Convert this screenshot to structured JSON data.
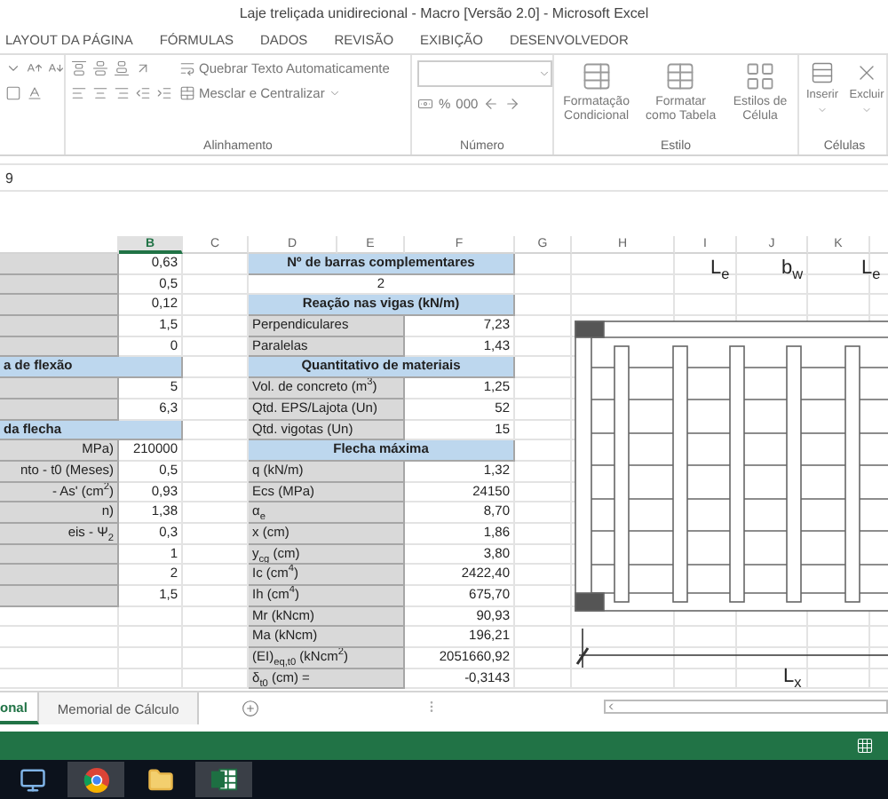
{
  "window": {
    "title": "Laje treliçada unidirecional - Macro [Versão 2.0] - Microsoft Excel"
  },
  "ribbon_tabs": [
    {
      "label": "LAYOUT DA PÁGINA",
      "selected": false
    },
    {
      "label": "FÓRMULAS",
      "selected": false
    },
    {
      "label": "DADOS",
      "selected": false
    },
    {
      "label": "REVISÃO",
      "selected": false
    },
    {
      "label": "EXIBIÇÃO",
      "selected": false
    },
    {
      "label": "DESENVOLVEDOR",
      "selected": false
    }
  ],
  "ribbon": {
    "alignment": {
      "wrap_text": "Quebrar Texto Automaticamente",
      "merge_center": "Mesclar e Centralizar",
      "label": "Alinhamento"
    },
    "number": {
      "buttons": [
        "%",
        "000"
      ],
      "label": "Número"
    },
    "styles": {
      "buttons": [
        "Formatação Condicional",
        "Formatar como Tabela",
        "Estilos de Célula"
      ],
      "label": "Estilo"
    },
    "cells": {
      "buttons": [
        "Inserir",
        "Excluir"
      ],
      "label": "Células"
    }
  },
  "formula_bar": {
    "value": "9"
  },
  "sheet": {
    "columns": [
      {
        "label": "B",
        "selected": true
      },
      {
        "label": "C",
        "selected": false
      },
      {
        "label": "D",
        "selected": false
      },
      {
        "label": "E",
        "selected": false
      },
      {
        "label": "F",
        "selected": false
      },
      {
        "label": "G",
        "selected": false
      },
      {
        "label": "H",
        "selected": false
      },
      {
        "label": "I",
        "selected": false
      },
      {
        "label": "J",
        "selected": false
      },
      {
        "label": "K",
        "selected": false
      }
    ],
    "left_rows": [
      {
        "kind": "value",
        "value": "0,63"
      },
      {
        "kind": "value",
        "value": "0,5"
      },
      {
        "kind": "value",
        "value": "0,12"
      },
      {
        "kind": "value",
        "value": "1,5"
      },
      {
        "kind": "value",
        "value": "0"
      },
      {
        "kind": "header",
        "label": "a de flexão"
      },
      {
        "kind": "value",
        "value": "5"
      },
      {
        "kind": "value",
        "value": "6,3"
      },
      {
        "kind": "header",
        "label": "da flecha"
      },
      {
        "kind": "value",
        "label": "MPa)",
        "value": "210000"
      },
      {
        "kind": "value",
        "label": "nto - t0 (Meses)",
        "value": "0,5"
      },
      {
        "kind": "value",
        "label": "- As' (cm$^{2}$)",
        "value": "0,93"
      },
      {
        "kind": "value",
        "label": "n)",
        "value": "1,38"
      },
      {
        "kind": "value",
        "label": "eis - Ψ$_{2}$",
        "value": "0,3"
      },
      {
        "kind": "value",
        "value": "1"
      },
      {
        "kind": "value",
        "value": "2"
      },
      {
        "kind": "value",
        "value": "1,5"
      }
    ],
    "right_rows": [
      {
        "kind": "header",
        "label": "Nº de barras complementares"
      },
      {
        "kind": "center",
        "value": "2"
      },
      {
        "kind": "header",
        "label": "Reação nas vigas (kN/m)"
      },
      {
        "kind": "value",
        "label": "Perpendiculares",
        "value": "7,23"
      },
      {
        "kind": "value",
        "label": "Paralelas",
        "value": "1,43"
      },
      {
        "kind": "header",
        "label": "Quantitativo de materiais"
      },
      {
        "kind": "value",
        "label": "Vol. de concreto (m$^{3}$)",
        "value": "1,25"
      },
      {
        "kind": "value",
        "label": "Qtd. EPS/Lajota (Un)",
        "value": "52"
      },
      {
        "kind": "value",
        "label": "Qtd. vigotas (Un)",
        "value": "15"
      },
      {
        "kind": "header",
        "label": "Flecha máxima"
      },
      {
        "kind": "value",
        "label": "q (kN/m)",
        "value": "1,32"
      },
      {
        "kind": "value",
        "label": "Ecs (MPa)",
        "value": "24150"
      },
      {
        "kind": "value",
        "label": "α$_{e}$",
        "value": "8,70"
      },
      {
        "kind": "value",
        "label": "x (cm)",
        "value": "1,86"
      },
      {
        "kind": "value",
        "label": "y$_{cg}$ (cm)",
        "value": "3,80"
      },
      {
        "kind": "value",
        "label": "Ic (cm$^{4}$)",
        "value": "2422,40"
      },
      {
        "kind": "value",
        "label": "Ih (cm$^{4}$)",
        "value": "675,70"
      },
      {
        "kind": "value",
        "label": "Mr (kNcm)",
        "value": "90,93"
      },
      {
        "kind": "value",
        "label": "Ma (kNcm)",
        "value": "196,21"
      },
      {
        "kind": "value",
        "label": "(EI)$_{eq,t0}$ (kNcm$^{2}$)",
        "value": "2051660,92"
      },
      {
        "kind": "value",
        "label": "δ$_{t0}$ (cm) =",
        "value": "-0,3143"
      }
    ]
  },
  "drawing": {
    "labels": [
      "L$_{e}$",
      "b$_{w}$",
      "L$_{e}$"
    ],
    "span_label": "L$_{x}$"
  },
  "sheet_tabs": [
    {
      "label": "onal",
      "selected": true
    },
    {
      "label": "Memorial de Cálculo",
      "selected": false
    }
  ]
}
